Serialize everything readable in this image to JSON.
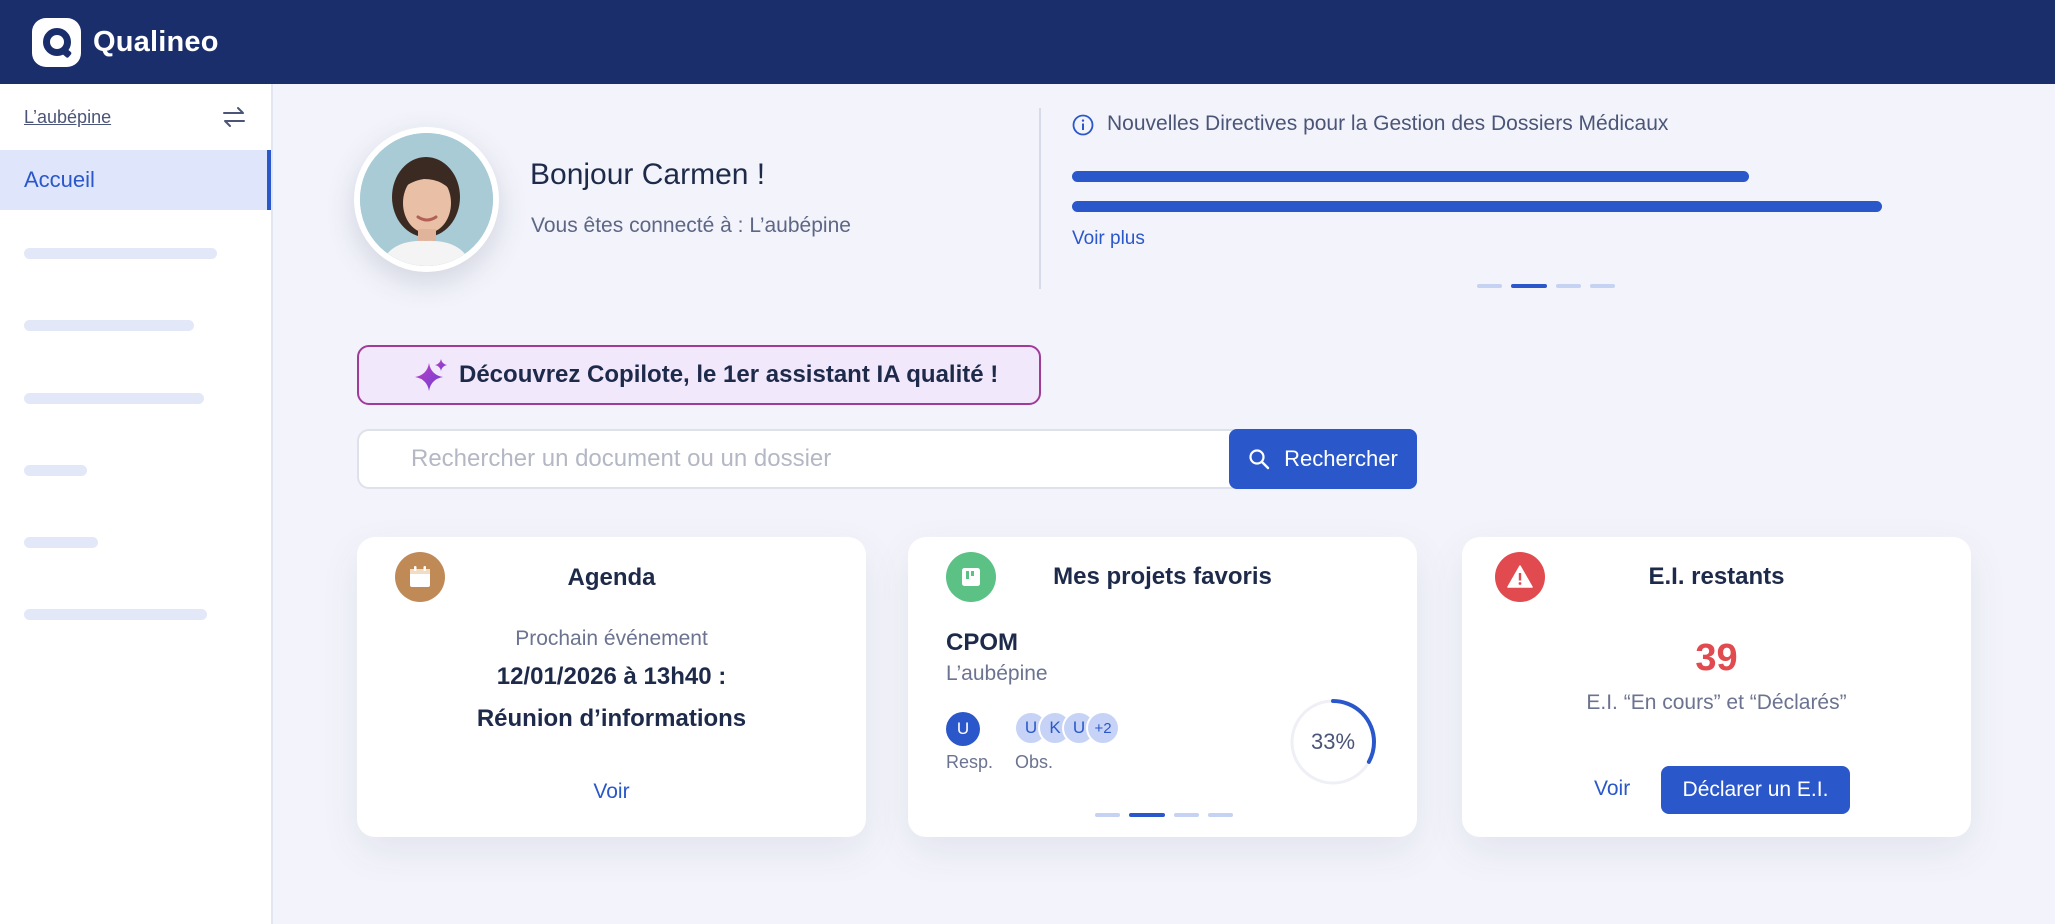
{
  "app": {
    "name": "Qualineo"
  },
  "sidebar": {
    "site_name": "L’aubépine",
    "active_item": "Accueil",
    "swap_icon": "swap-arrows-icon"
  },
  "welcome": {
    "greeting": "Bonjour Carmen !",
    "connected_text": "Vous êtes connecté à : L’aubépine"
  },
  "news": {
    "title": "Nouvelles Directives pour la Gestion des Dossiers Médicaux",
    "link": "Voir plus",
    "carousel_active_index": 1,
    "carousel_count": 4
  },
  "copilote": {
    "text": "Découvrez Copilote, le 1er assistant IA qualité !"
  },
  "search": {
    "placeholder": "Rechercher un document ou un dossier",
    "button_label": "Rechercher"
  },
  "cards": {
    "agenda": {
      "title": "Agenda",
      "subtitle": "Prochain événement",
      "date": "12/01/2026 à 13h40 :",
      "event": "Réunion d’informations",
      "link": "Voir"
    },
    "projects": {
      "title": "Mes projets favoris",
      "project_name": "CPOM",
      "project_site": "L’aubépine",
      "resp_label": "Resp.",
      "obs_label": "Obs.",
      "resp_initials": "U",
      "obs_initials": [
        "U",
        "K",
        "U",
        "+2"
      ],
      "progress_text": "33%",
      "progress_value": 0.33,
      "carousel_active_index": 1,
      "carousel_count": 4
    },
    "ei": {
      "title": "E.I. restants",
      "count": "39",
      "subtitle": "E.I. “En cours” et “Déclarés”",
      "link": "Voir",
      "button_label": "Déclarer un E.I."
    }
  },
  "colors": {
    "topbar": "#1a2e6c",
    "accent": "#2a57c9",
    "danger": "#e14a4e",
    "agenda_icon": "#c08a57",
    "projects_icon": "#5bc184",
    "copilote_border": "#a03b9a"
  }
}
